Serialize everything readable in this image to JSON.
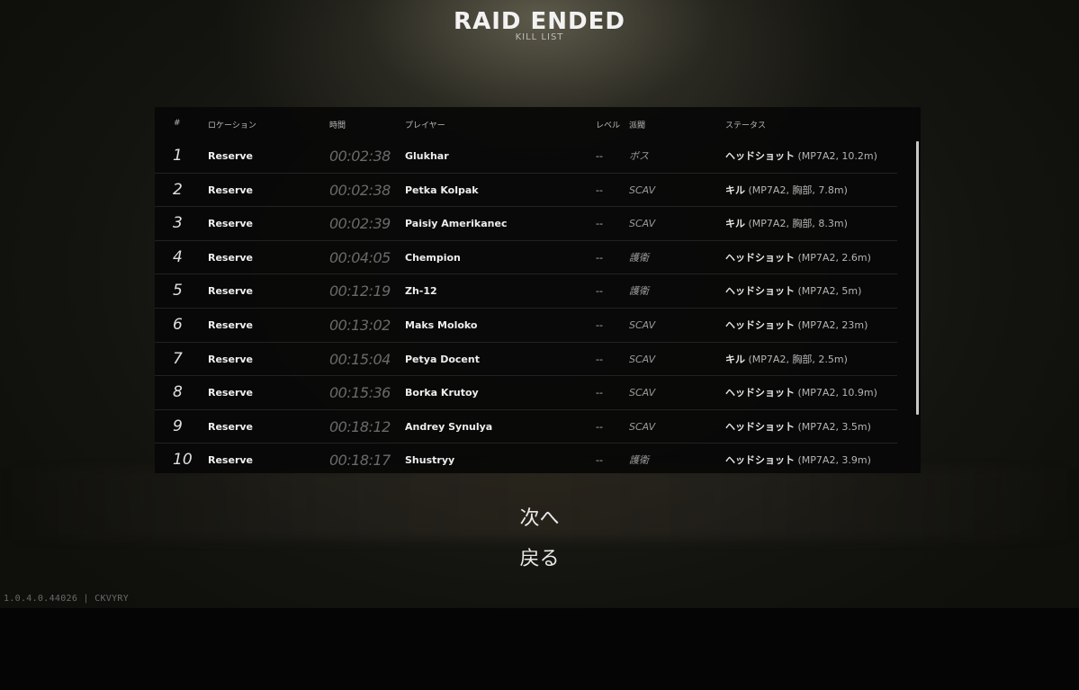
{
  "title": "RAID ENDED",
  "subtitle": "KILL LIST",
  "table": {
    "headers": {
      "num": "#",
      "location": "ロケーション",
      "time": "時間",
      "player": "プレイヤー",
      "level": "レベル",
      "faction": "派閥",
      "status": "ステータス"
    },
    "rows": [
      {
        "num": "1",
        "location": "Reserve",
        "time": "00:02:38",
        "player": "Glukhar",
        "level": "--",
        "faction": "ボス",
        "status": "ヘッドショット",
        "detail": "(MP7A2, 10.2m)"
      },
      {
        "num": "2",
        "location": "Reserve",
        "time": "00:02:38",
        "player": "Petka Kolpak",
        "level": "--",
        "faction": "SCAV",
        "status": "キル",
        "detail": "(MP7A2, 胸部, 7.8m)"
      },
      {
        "num": "3",
        "location": "Reserve",
        "time": "00:02:39",
        "player": "Paisiy Amerikanec",
        "level": "--",
        "faction": "SCAV",
        "status": "キル",
        "detail": "(MP7A2, 胸部, 8.3m)"
      },
      {
        "num": "4",
        "location": "Reserve",
        "time": "00:04:05",
        "player": "Chempion",
        "level": "--",
        "faction": "護衛",
        "status": "ヘッドショット",
        "detail": "(MP7A2, 2.6m)"
      },
      {
        "num": "5",
        "location": "Reserve",
        "time": "00:12:19",
        "player": "Zh-12",
        "level": "--",
        "faction": "護衛",
        "status": "ヘッドショット",
        "detail": "(MP7A2, 5m)"
      },
      {
        "num": "6",
        "location": "Reserve",
        "time": "00:13:02",
        "player": "Maks Moloko",
        "level": "--",
        "faction": "SCAV",
        "status": "ヘッドショット",
        "detail": "(MP7A2, 23m)"
      },
      {
        "num": "7",
        "location": "Reserve",
        "time": "00:15:04",
        "player": "Petya Docent",
        "level": "--",
        "faction": "SCAV",
        "status": "キル",
        "detail": "(MP7A2, 胸部, 2.5m)"
      },
      {
        "num": "8",
        "location": "Reserve",
        "time": "00:15:36",
        "player": "Borka Krutoy",
        "level": "--",
        "faction": "SCAV",
        "status": "ヘッドショット",
        "detail": "(MP7A2, 10.9m)"
      },
      {
        "num": "9",
        "location": "Reserve",
        "time": "00:18:12",
        "player": "Andrey Synulya",
        "level": "--",
        "faction": "SCAV",
        "status": "ヘッドショット",
        "detail": "(MP7A2, 3.5m)"
      },
      {
        "num": "10",
        "location": "Reserve",
        "time": "00:18:17",
        "player": "Shustryy",
        "level": "--",
        "faction": "護衛",
        "status": "ヘッドショット",
        "detail": "(MP7A2, 3.9m)"
      }
    ]
  },
  "buttons": {
    "next": "次へ",
    "back": "戻る"
  },
  "version": "1.0.4.0.44026 | CKVYRY"
}
